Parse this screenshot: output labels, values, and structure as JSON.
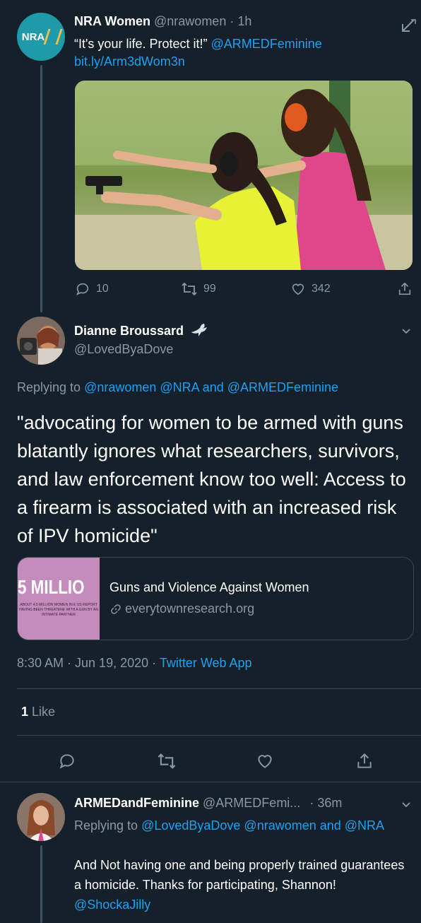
{
  "tweet1": {
    "avatar_text": "NRA",
    "name": "NRA Women",
    "handle": "@nrawomen",
    "time": "1h",
    "text_plain": "“It's your life. Protect it!”",
    "text_mention": "@ARMEDFeminine",
    "link": "bit.ly/Arm3dWom3n",
    "media_description": "two women with ear protection at a shooting range",
    "replies": "10",
    "retweets": "99",
    "likes": "342"
  },
  "tweet2": {
    "name": "Dianne Broussard",
    "handle": "@LovedByaDove",
    "replying_label": "Replying to",
    "replying_to": "@nrawomen @NRA and @ARMEDFeminine",
    "text": "\"advocating for women to be armed with guns blatantly ignores what researchers, survivors, and law enforcement know too well: Access to a firearm is associated with an increased risk of IPV homicide\"",
    "card": {
      "image_big_text": "5 MILLIO",
      "image_small_text": "ABOUT 4.5 MILLION WOMEN IN E US REPORT HAVING BEEN THREATENE WITH A GUN BY AN INTIMATE PARTNER",
      "title": "Guns and Violence Against Women",
      "domain": "everytownresearch.org"
    },
    "timestamp": "8:30 AM · Jun 19, 2020 ·",
    "source": "Twitter Web App",
    "like_count": "1",
    "like_label": "Like"
  },
  "tweet3": {
    "name": "ARMEDandFeminine",
    "handle": "@ARMEDFemi...",
    "time": "· 36m",
    "replying_label": "Replying to",
    "replying_to": "@LovedByaDove @nrawomen and @NRA",
    "text": "And Not having one and being properly trained guarantees a homicide. Thanks for participating, Shannon!",
    "mention": "@ShockaJilly"
  },
  "colors": {
    "background": "#15202b",
    "muted": "#8899a6",
    "link": "#1da1f2",
    "divider": "#38444d"
  }
}
